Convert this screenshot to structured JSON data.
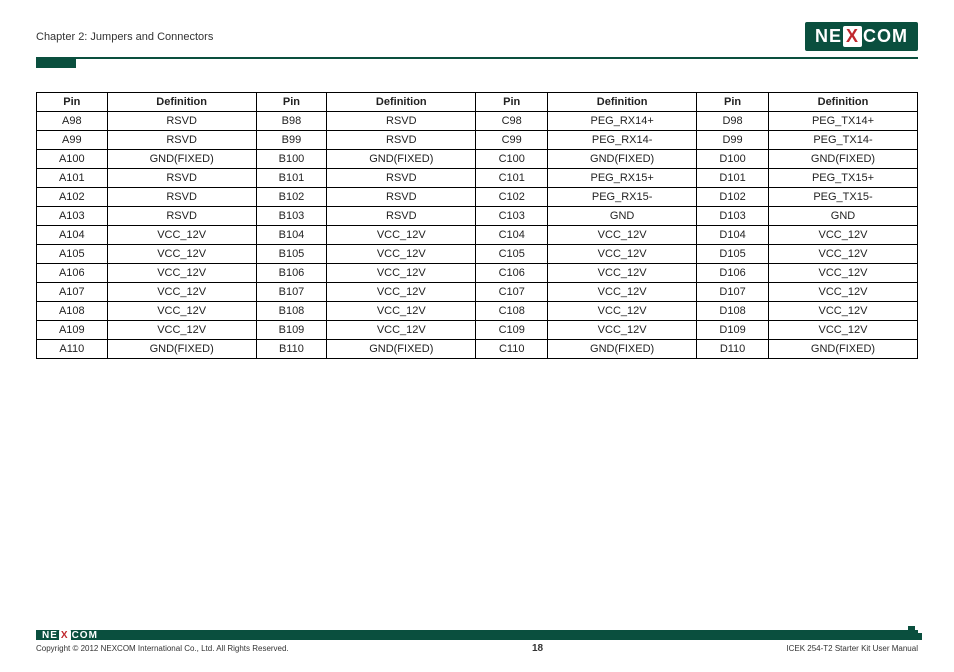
{
  "header": {
    "chapter_title": "Chapter 2: Jumpers and Connectors",
    "logo_text_pre": "NE",
    "logo_text_x": "X",
    "logo_text_post": "COM"
  },
  "table": {
    "headers": [
      "Pin",
      "Definition",
      "Pin",
      "Definition",
      "Pin",
      "Definition",
      "Pin",
      "Definition"
    ],
    "rows": [
      [
        "A98",
        "RSVD",
        "B98",
        "RSVD",
        "C98",
        "PEG_RX14+",
        "D98",
        "PEG_TX14+"
      ],
      [
        "A99",
        "RSVD",
        "B99",
        "RSVD",
        "C99",
        "PEG_RX14-",
        "D99",
        "PEG_TX14-"
      ],
      [
        "A100",
        "GND(FIXED)",
        "B100",
        "GND(FIXED)",
        "C100",
        "GND(FIXED)",
        "D100",
        "GND(FIXED)"
      ],
      [
        "A101",
        "RSVD",
        "B101",
        "RSVD",
        "C101",
        "PEG_RX15+",
        "D101",
        "PEG_TX15+"
      ],
      [
        "A102",
        "RSVD",
        "B102",
        "RSVD",
        "C102",
        "PEG_RX15-",
        "D102",
        "PEG_TX15-"
      ],
      [
        "A103",
        "RSVD",
        "B103",
        "RSVD",
        "C103",
        "GND",
        "D103",
        "GND"
      ],
      [
        "A104",
        "VCC_12V",
        "B104",
        "VCC_12V",
        "C104",
        "VCC_12V",
        "D104",
        "VCC_12V"
      ],
      [
        "A105",
        "VCC_12V",
        "B105",
        "VCC_12V",
        "C105",
        "VCC_12V",
        "D105",
        "VCC_12V"
      ],
      [
        "A106",
        "VCC_12V",
        "B106",
        "VCC_12V",
        "C106",
        "VCC_12V",
        "D106",
        "VCC_12V"
      ],
      [
        "A107",
        "VCC_12V",
        "B107",
        "VCC_12V",
        "C107",
        "VCC_12V",
        "D107",
        "VCC_12V"
      ],
      [
        "A108",
        "VCC_12V",
        "B108",
        "VCC_12V",
        "C108",
        "VCC_12V",
        "D108",
        "VCC_12V"
      ],
      [
        "A109",
        "VCC_12V",
        "B109",
        "VCC_12V",
        "C109",
        "VCC_12V",
        "D109",
        "VCC_12V"
      ],
      [
        "A110",
        "GND(FIXED)",
        "B110",
        "GND(FIXED)",
        "C110",
        "GND(FIXED)",
        "D110",
        "GND(FIXED)"
      ]
    ]
  },
  "footer": {
    "copyright": "Copyright © 2012 NEXCOM International Co., Ltd. All Rights Reserved.",
    "page_number": "18",
    "manual_title": "ICEK 254-T2 Starter Kit User Manual",
    "logo_text_pre": "NE",
    "logo_text_x": "X",
    "logo_text_post": "COM"
  }
}
